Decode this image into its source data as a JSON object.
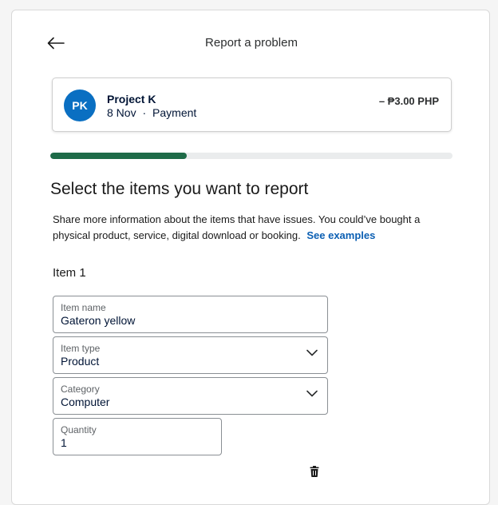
{
  "header": {
    "title": "Report a problem",
    "back_icon": "arrow-left-icon"
  },
  "transaction": {
    "avatar_initials": "PK",
    "avatar_color": "#0a6fc2",
    "merchant": "Project K",
    "date": "8 Nov",
    "separator": "·",
    "type": "Payment",
    "amount": "– ₱3.00 PHP"
  },
  "progress": {
    "fraction": 0.34,
    "color": "#1e6b48"
  },
  "main": {
    "heading": "Select the items you want to report",
    "description": "Share more information about the items that have issues. You could’ve bought a physical product, service, digital download or booking.",
    "examples_link": "See examples",
    "item_label": "Item 1"
  },
  "form": {
    "item_name": {
      "label": "Item name",
      "value": "Gateron yellow"
    },
    "item_type": {
      "label": "Item type",
      "value": "Product"
    },
    "category": {
      "label": "Category",
      "value": "Computer"
    },
    "quantity": {
      "label": "Quantity",
      "value": "1"
    }
  },
  "icons": {
    "delete": "trash-icon",
    "dropdown": "chevron-down-icon"
  }
}
